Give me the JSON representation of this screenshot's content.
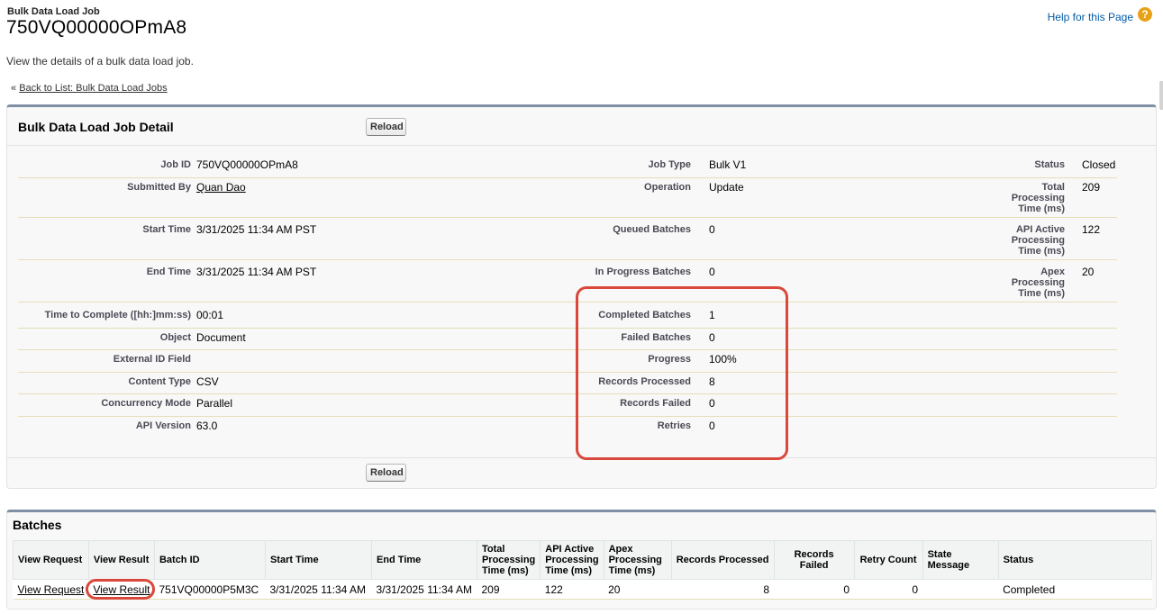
{
  "page": {
    "type_label": "Bulk Data Load Job",
    "title": "750VQ00000OPmA8",
    "help_link": "Help for this Page",
    "help_icon": "help-icon",
    "description": "View the details of a bulk data load job.",
    "back_prefix": "«",
    "back_link": "Back to List: Bulk Data Load Jobs"
  },
  "detail": {
    "header": "Bulk Data Load Job Detail",
    "reload_label": "Reload",
    "col1": [
      {
        "label": "Job ID",
        "value": "750VQ00000OPmA8"
      },
      {
        "label": "Submitted By",
        "value": "Quan Dao"
      },
      {
        "label": "Start Time",
        "value": "3/31/2025 11:34 AM PST"
      },
      {
        "label": "End Time",
        "value": "3/31/2025 11:34 AM PST"
      },
      {
        "label": "Time to Complete ([hh:]mm:ss)",
        "value": "00:01"
      },
      {
        "label": "Object",
        "value": "Document"
      },
      {
        "label": "External ID Field",
        "value": ""
      },
      {
        "label": "Content Type",
        "value": "CSV"
      },
      {
        "label": "Concurrency Mode",
        "value": "Parallel"
      },
      {
        "label": "API Version",
        "value": "63.0"
      }
    ],
    "col2": [
      {
        "label": "Job Type",
        "value": "Bulk V1"
      },
      {
        "label": "Operation",
        "value": "Update"
      },
      {
        "label": "Queued Batches",
        "value": "0"
      },
      {
        "label": "In Progress Batches",
        "value": "0"
      },
      {
        "label": "Completed Batches",
        "value": "1"
      },
      {
        "label": "Failed Batches",
        "value": "0"
      },
      {
        "label": "Progress",
        "value": "100%"
      },
      {
        "label": "Records Processed",
        "value": "8"
      },
      {
        "label": "Records Failed",
        "value": "0"
      },
      {
        "label": "Retries",
        "value": "0"
      }
    ],
    "col3": [
      {
        "label_lines": [
          "Status"
        ],
        "value": "Closed"
      },
      {
        "label_lines": [
          "Total",
          "Processing",
          "Time (ms)"
        ],
        "value": "209"
      },
      {
        "label_lines": [
          "API Active",
          "Processing",
          "Time (ms)"
        ],
        "value": "122"
      },
      {
        "label_lines": [
          "Apex",
          "Processing",
          "Time (ms)"
        ],
        "value": "20"
      }
    ]
  },
  "batches": {
    "header": "Batches",
    "columns": [
      {
        "lines": [
          "View Request"
        ]
      },
      {
        "lines": [
          "View Result"
        ]
      },
      {
        "lines": [
          "Batch ID"
        ]
      },
      {
        "lines": [
          "Start Time"
        ]
      },
      {
        "lines": [
          "End Time"
        ]
      },
      {
        "lines": [
          "Total",
          "Processing",
          "Time (ms)"
        ]
      },
      {
        "lines": [
          "API Active",
          "Processing",
          "Time (ms)"
        ]
      },
      {
        "lines": [
          "Apex",
          "Processing",
          "Time (ms)"
        ]
      },
      {
        "lines": [
          "Records Processed"
        ]
      },
      {
        "lines": [
          "Records Failed"
        ]
      },
      {
        "lines": [
          "Retry Count"
        ]
      },
      {
        "lines": [
          "State Message"
        ]
      },
      {
        "lines": [
          "Status"
        ]
      }
    ],
    "rows": [
      {
        "view_request": "View Request",
        "view_result": "View Result",
        "batch_id": "751VQ00000P5M3C",
        "start_time": "3/31/2025 11:34 AM",
        "end_time": "3/31/2025 11:34 AM",
        "total_time": "209",
        "api_active_time": "122",
        "apex_time": "20",
        "records_processed": "8",
        "records_failed": "0",
        "retry_count": "0",
        "state_message": "",
        "status": "Completed"
      }
    ]
  },
  "colors": {
    "highlight": "#d9483b",
    "link": "#015ba7",
    "panel_border": "#7f8fa4"
  }
}
